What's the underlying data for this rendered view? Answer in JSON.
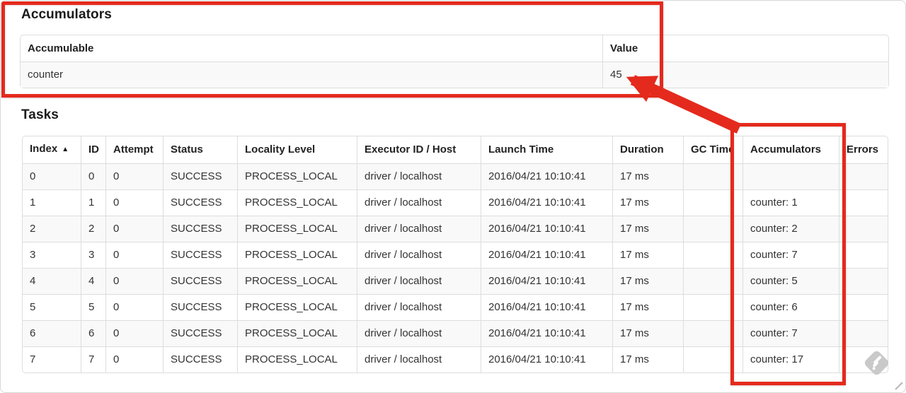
{
  "accumulators_section": {
    "title": "Accumulators",
    "table": {
      "headers": [
        "Accumulable",
        "Value"
      ],
      "rows": [
        {
          "accumulable": "counter",
          "value": "45"
        }
      ]
    }
  },
  "tasks_section": {
    "title": "Tasks",
    "table": {
      "headers": [
        "Index",
        "ID",
        "Attempt",
        "Status",
        "Locality Level",
        "Executor ID / Host",
        "Launch Time",
        "Duration",
        "GC Time",
        "Accumulators",
        "Errors"
      ],
      "sort": {
        "column": "Index",
        "direction": "ascending",
        "icon": "▲"
      },
      "rows": [
        {
          "index": "0",
          "id": "0",
          "attempt": "0",
          "status": "SUCCESS",
          "locality_level": "PROCESS_LOCAL",
          "executor_id_host": "driver / localhost",
          "launch_time": "2016/04/21 10:10:41",
          "duration": "17 ms",
          "gc_time": "",
          "accumulators": "",
          "errors": ""
        },
        {
          "index": "1",
          "id": "1",
          "attempt": "0",
          "status": "SUCCESS",
          "locality_level": "PROCESS_LOCAL",
          "executor_id_host": "driver / localhost",
          "launch_time": "2016/04/21 10:10:41",
          "duration": "17 ms",
          "gc_time": "",
          "accumulators": "counter: 1",
          "errors": ""
        },
        {
          "index": "2",
          "id": "2",
          "attempt": "0",
          "status": "SUCCESS",
          "locality_level": "PROCESS_LOCAL",
          "executor_id_host": "driver / localhost",
          "launch_time": "2016/04/21 10:10:41",
          "duration": "17 ms",
          "gc_time": "",
          "accumulators": "counter: 2",
          "errors": ""
        },
        {
          "index": "3",
          "id": "3",
          "attempt": "0",
          "status": "SUCCESS",
          "locality_level": "PROCESS_LOCAL",
          "executor_id_host": "driver / localhost",
          "launch_time": "2016/04/21 10:10:41",
          "duration": "17 ms",
          "gc_time": "",
          "accumulators": "counter: 7",
          "errors": ""
        },
        {
          "index": "4",
          "id": "4",
          "attempt": "0",
          "status": "SUCCESS",
          "locality_level": "PROCESS_LOCAL",
          "executor_id_host": "driver / localhost",
          "launch_time": "2016/04/21 10:10:41",
          "duration": "17 ms",
          "gc_time": "",
          "accumulators": "counter: 5",
          "errors": ""
        },
        {
          "index": "5",
          "id": "5",
          "attempt": "0",
          "status": "SUCCESS",
          "locality_level": "PROCESS_LOCAL",
          "executor_id_host": "driver / localhost",
          "launch_time": "2016/04/21 10:10:41",
          "duration": "17 ms",
          "gc_time": "",
          "accumulators": "counter: 6",
          "errors": ""
        },
        {
          "index": "6",
          "id": "6",
          "attempt": "0",
          "status": "SUCCESS",
          "locality_level": "PROCESS_LOCAL",
          "executor_id_host": "driver / localhost",
          "launch_time": "2016/04/21 10:10:41",
          "duration": "17 ms",
          "gc_time": "",
          "accumulators": "counter: 7",
          "errors": ""
        },
        {
          "index": "7",
          "id": "7",
          "attempt": "0",
          "status": "SUCCESS",
          "locality_level": "PROCESS_LOCAL",
          "executor_id_host": "driver / localhost",
          "launch_time": "2016/04/21 10:10:41",
          "duration": "17 ms",
          "gc_time": "",
          "accumulators": "counter: 17",
          "errors": ""
        }
      ]
    }
  },
  "annotations": {
    "accent_color": "#e42a1d",
    "watermark_icon_name": "skitch-watermark-icon"
  }
}
